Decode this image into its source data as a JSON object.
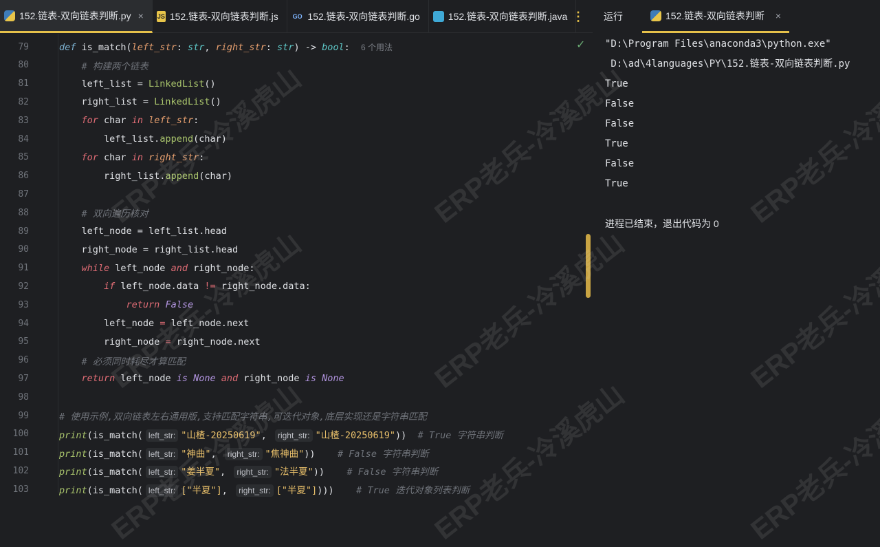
{
  "tabs": [
    {
      "label": "152.链表-双向链表判断.py",
      "icon": "python-icon",
      "active": true
    },
    {
      "label": "152.链表-双向链表判断.js",
      "icon": "js-icon"
    },
    {
      "label": "152.链表-双向链表判断.go",
      "icon": "go-icon"
    },
    {
      "label": "152.链表-双向链表判断.java",
      "icon": "java-icon"
    }
  ],
  "run": {
    "label": "运行",
    "tab_label": "152.链表-双向链表判断",
    "output": [
      "\"D:\\Program Files\\anaconda3\\python.exe\"",
      " D:\\ad\\4languages\\PY\\152.链表-双向链表判断.py",
      "True",
      "False",
      "False",
      "True",
      "False",
      "True",
      "",
      "进程已结束，退出代码为 0"
    ]
  },
  "watermark": "ERP老兵-冷溪虎山",
  "code": [
    {
      "n": "79",
      "t": [
        [
          "def",
          "def"
        ],
        [
          "plain",
          " is_match("
        ],
        [
          "param",
          "left_str"
        ],
        [
          "plain",
          ": "
        ],
        [
          "type",
          "str"
        ],
        [
          "plain",
          ", "
        ],
        [
          "param",
          "right_str"
        ],
        [
          "plain",
          ": "
        ],
        [
          "type",
          "str"
        ],
        [
          "plain",
          ") -> "
        ],
        [
          "type",
          "bool"
        ],
        [
          "plain",
          ":  "
        ],
        [
          "usage",
          "6 个用法"
        ]
      ]
    },
    {
      "n": "80",
      "t": [
        [
          "plain",
          "    "
        ],
        [
          "com",
          "# 构建两个链表"
        ]
      ]
    },
    {
      "n": "81",
      "t": [
        [
          "plain",
          "    left_list = "
        ],
        [
          "cls",
          "LinkedList"
        ],
        [
          "plain",
          "()"
        ]
      ]
    },
    {
      "n": "82",
      "t": [
        [
          "plain",
          "    right_list = "
        ],
        [
          "cls",
          "LinkedList"
        ],
        [
          "plain",
          "()"
        ]
      ]
    },
    {
      "n": "83",
      "t": [
        [
          "plain",
          "    "
        ],
        [
          "kw",
          "for"
        ],
        [
          "plain",
          " char "
        ],
        [
          "kw",
          "in"
        ],
        [
          "plain",
          " "
        ],
        [
          "param",
          "left_str"
        ],
        [
          "plain",
          ":"
        ]
      ]
    },
    {
      "n": "84",
      "t": [
        [
          "plain",
          "        left_list."
        ],
        [
          "cls",
          "append"
        ],
        [
          "plain",
          "(char)"
        ]
      ]
    },
    {
      "n": "85",
      "t": [
        [
          "plain",
          "    "
        ],
        [
          "kw",
          "for"
        ],
        [
          "plain",
          " char "
        ],
        [
          "kw",
          "in"
        ],
        [
          "plain",
          " "
        ],
        [
          "param",
          "right_str"
        ],
        [
          "plain",
          ":"
        ]
      ]
    },
    {
      "n": "86",
      "t": [
        [
          "plain",
          "        right_list."
        ],
        [
          "cls",
          "append"
        ],
        [
          "plain",
          "(char)"
        ]
      ]
    },
    {
      "n": "87",
      "t": []
    },
    {
      "n": "88",
      "t": [
        [
          "plain",
          "    "
        ],
        [
          "com",
          "# 双向遍历核对"
        ]
      ]
    },
    {
      "n": "89",
      "t": [
        [
          "plain",
          "    left_node = left_list.head"
        ]
      ]
    },
    {
      "n": "90",
      "t": [
        [
          "plain",
          "    right_node = right_list.head"
        ]
      ]
    },
    {
      "n": "91",
      "t": [
        [
          "plain",
          "    "
        ],
        [
          "kw",
          "while"
        ],
        [
          "plain",
          " left_node "
        ],
        [
          "kw",
          "and"
        ],
        [
          "plain",
          " right_node:"
        ]
      ]
    },
    {
      "n": "92",
      "t": [
        [
          "plain",
          "        "
        ],
        [
          "kw",
          "if"
        ],
        [
          "plain",
          " left_node.data "
        ],
        [
          "op",
          "!="
        ],
        [
          "plain",
          " right_node.data:"
        ]
      ]
    },
    {
      "n": "93",
      "t": [
        [
          "plain",
          "            "
        ],
        [
          "kw",
          "return"
        ],
        [
          "plain",
          " "
        ],
        [
          "const",
          "False"
        ]
      ]
    },
    {
      "n": "94",
      "t": [
        [
          "plain",
          "        left_node "
        ],
        [
          "op",
          "="
        ],
        [
          "plain",
          " left_node.next"
        ]
      ]
    },
    {
      "n": "95",
      "t": [
        [
          "plain",
          "        right_node "
        ],
        [
          "op",
          "="
        ],
        [
          "plain",
          " right_node.next"
        ]
      ]
    },
    {
      "n": "96",
      "t": [
        [
          "plain",
          "    "
        ],
        [
          "com",
          "# 必须同时耗尽才算匹配"
        ]
      ]
    },
    {
      "n": "97",
      "t": [
        [
          "plain",
          "    "
        ],
        [
          "kw",
          "return"
        ],
        [
          "plain",
          " left_node "
        ],
        [
          "const",
          "is None"
        ],
        [
          "plain",
          " "
        ],
        [
          "kw",
          "and"
        ],
        [
          "plain",
          " right_node "
        ],
        [
          "const",
          "is None"
        ]
      ]
    },
    {
      "n": "98",
      "t": []
    },
    {
      "n": "99",
      "t": [
        [
          "com",
          "# 使用示例,双向链表左右通用版,支持匹配字符串,可迭代对象,底层实现还是字符串匹配"
        ]
      ]
    },
    {
      "n": "100",
      "t": [
        [
          "call",
          "print"
        ],
        [
          "plain",
          "(is_match("
        ],
        [
          "hint",
          "left_str:"
        ],
        [
          "str",
          "\"山楂-20250619\""
        ],
        [
          "plain",
          ", "
        ],
        [
          "hint",
          "right_str:"
        ],
        [
          "str",
          "\"山楂-20250619\""
        ],
        [
          "plain",
          "))  "
        ],
        [
          "com",
          "# True 字符串判断"
        ]
      ]
    },
    {
      "n": "101",
      "t": [
        [
          "call",
          "print"
        ],
        [
          "plain",
          "(is_match("
        ],
        [
          "hint",
          "left_str:"
        ],
        [
          "str",
          "\"神曲\""
        ],
        [
          "plain",
          ", "
        ],
        [
          "hint",
          "right_str:"
        ],
        [
          "str",
          "\"焦神曲\""
        ],
        [
          "plain",
          "))    "
        ],
        [
          "com",
          "# False 字符串判断"
        ]
      ]
    },
    {
      "n": "102",
      "t": [
        [
          "call",
          "print"
        ],
        [
          "plain",
          "(is_match("
        ],
        [
          "hint",
          "left_str:"
        ],
        [
          "str",
          "\"姜半夏\""
        ],
        [
          "plain",
          ", "
        ],
        [
          "hint",
          "right_str:"
        ],
        [
          "str",
          "\"法半夏\""
        ],
        [
          "plain",
          "))    "
        ],
        [
          "com",
          "# False 字符串判断"
        ]
      ]
    },
    {
      "n": "103",
      "t": [
        [
          "call",
          "print"
        ],
        [
          "plain",
          "(is_match("
        ],
        [
          "hint",
          "left_str:"
        ],
        [
          "str",
          "[\"半夏\"]"
        ],
        [
          "plain",
          ", "
        ],
        [
          "hint",
          "right_str:"
        ],
        [
          "str",
          "[\"半夏\"]"
        ],
        [
          "plain",
          ")))    "
        ],
        [
          "com",
          "# True 迭代对象列表判断"
        ]
      ]
    }
  ]
}
